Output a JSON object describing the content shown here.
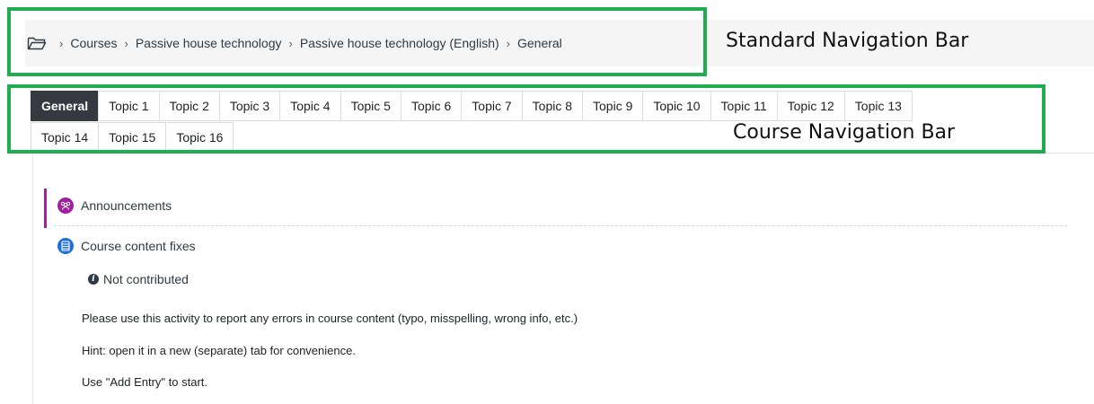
{
  "annotations": {
    "standard_nav": "Standard Navigation Bar",
    "course_nav": "Course Navigation Bar"
  },
  "breadcrumb": {
    "separator": "›",
    "items": [
      "Courses",
      "Passive house technology",
      "Passive house technology (English)",
      "General"
    ]
  },
  "tabs": {
    "row1": [
      "General",
      "Topic 1",
      "Topic 2",
      "Topic 3",
      "Topic 4",
      "Topic 5",
      "Topic 6",
      "Topic 7",
      "Topic 8",
      "Topic 9",
      "Topic 10",
      "Topic 11",
      "Topic 12",
      "Topic 13"
    ],
    "row2": [
      "Topic 14",
      "Topic 15",
      "Topic 16"
    ],
    "active": "General"
  },
  "activities": {
    "announcements": {
      "label": "Announcements",
      "icon": "forum-icon",
      "color": "#a020a0"
    },
    "fixes": {
      "label": "Course content fixes",
      "icon": "glossary-icon",
      "color": "#1f6fd8"
    }
  },
  "status": {
    "label": "Not contributed",
    "icon": "info-icon"
  },
  "description": {
    "line1": "Please use this activity to report any errors in course content (typo, misspelling, wrong info, etc.)",
    "line2": "Hint: open it in a new (separate) tab for convenience.",
    "line3": "Use \"Add Entry\" to start."
  },
  "colors": {
    "highlight": "#1fad4f",
    "active_tab": "#343a40"
  }
}
